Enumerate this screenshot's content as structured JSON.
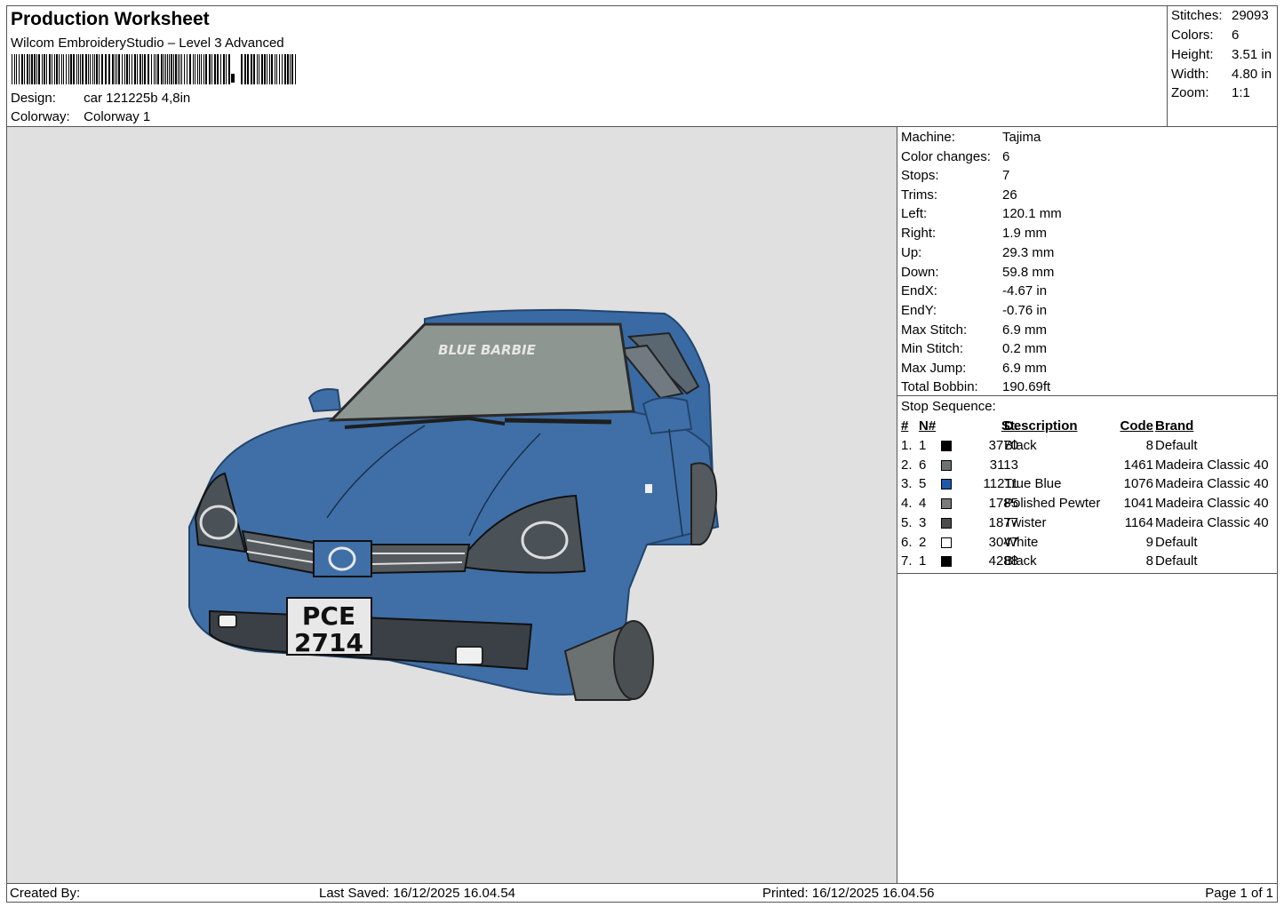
{
  "header": {
    "title": "Production Worksheet",
    "subtitle": "Wilcom EmbroideryStudio – Level 3 Advanced",
    "design_label": "Design:",
    "design_value": "car 121225b 4,8in",
    "colorway_label": "Colorway:",
    "colorway_value": "Colorway 1"
  },
  "stats": [
    {
      "label": "Stitches:",
      "value": "29093"
    },
    {
      "label": "Colors:",
      "value": "6"
    },
    {
      "label": "Height:",
      "value": "3.51 in"
    },
    {
      "label": "Width:",
      "value": "4.80 in"
    },
    {
      "label": "Zoom:",
      "value": "1:1"
    }
  ],
  "machine_info": [
    {
      "label": "Machine:",
      "value": "Tajima"
    },
    {
      "label": "Color changes:",
      "value": "6"
    },
    {
      "label": "Stops:",
      "value": "7"
    },
    {
      "label": "Trims:",
      "value": "26"
    },
    {
      "label": "Left:",
      "value": "120.1 mm"
    },
    {
      "label": "Right:",
      "value": "1.9 mm"
    },
    {
      "label": "Up:",
      "value": "29.3 mm"
    },
    {
      "label": "Down:",
      "value": "59.8 mm"
    },
    {
      "label": "EndX:",
      "value": "-4.67 in"
    },
    {
      "label": "EndY:",
      "value": "-0.76 in"
    },
    {
      "label": "Max Stitch:",
      "value": "6.9 mm"
    },
    {
      "label": "Min Stitch:",
      "value": "0.2 mm"
    },
    {
      "label": "Max Jump:",
      "value": "6.9 mm"
    },
    {
      "label": "Total Bobbin:",
      "value": "190.69ft"
    }
  ],
  "stop_sequence": {
    "caption": "Stop Sequence:",
    "headers": {
      "num": "#",
      "n": "N#",
      "st": "St.",
      "description": "Description",
      "code": "Code",
      "brand": "Brand"
    },
    "rows": [
      {
        "num": "1.",
        "n": "1",
        "color": "#000000",
        "st": "3770",
        "description": "Black",
        "code": "8",
        "brand": "Default"
      },
      {
        "num": "2.",
        "n": "6",
        "color": "#6c7472",
        "st": "3113",
        "description": "",
        "code": "1461",
        "brand": "Madeira Classic 40"
      },
      {
        "num": "3.",
        "n": "5",
        "color": "#1f58a8",
        "st": "11211",
        "description": "True Blue",
        "code": "1076",
        "brand": "Madeira Classic 40"
      },
      {
        "num": "4.",
        "n": "4",
        "color": "#7a7a7a",
        "st": "1785",
        "description": "Polished Pewter",
        "code": "1041",
        "brand": "Madeira Classic 40"
      },
      {
        "num": "5.",
        "n": "3",
        "color": "#4c4c4c",
        "st": "1877",
        "description": "Twister",
        "code": "1164",
        "brand": "Madeira Classic 40"
      },
      {
        "num": "6.",
        "n": "2",
        "color": "#ffffff",
        "st": "3047",
        "description": "White",
        "code": "9",
        "brand": "Default"
      },
      {
        "num": "7.",
        "n": "1",
        "color": "#000000",
        "st": "4288",
        "description": "Black",
        "code": "8",
        "brand": "Default"
      }
    ]
  },
  "design_preview": {
    "windshield_text": "BLUE BARBIE",
    "plate_line1": "PCE",
    "plate_line2": "2714",
    "body_color": "#3f6fa6",
    "canvas_color": "#e0e0e0"
  },
  "footer": {
    "created_by": "Created By:",
    "last_saved": "Last Saved: 16/12/2025 16.04.54",
    "printed": "Printed: 16/12/2025 16.04.56",
    "page": "Page 1 of 1"
  }
}
